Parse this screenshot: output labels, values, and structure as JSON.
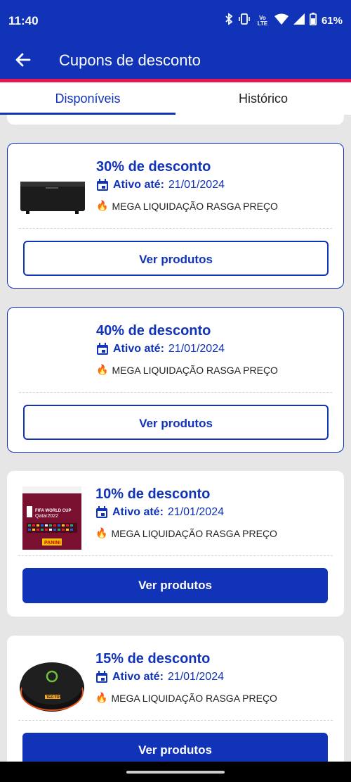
{
  "status_bar": {
    "time": "11:40",
    "signal_label": "Vo LTE",
    "battery": "61%",
    "icons": [
      "bluetooth-icon",
      "vibrate-icon",
      "volte-icon",
      "wifi-icon",
      "signal-icon",
      "battery-icon"
    ]
  },
  "app_bar": {
    "title": "Cupons de desconto",
    "back_icon": "arrow-left-icon"
  },
  "tabs": [
    {
      "label": "Disponíveis",
      "active": true
    },
    {
      "label": "Histórico",
      "active": false
    }
  ],
  "coupons": [
    {
      "discount": "30% de desconto",
      "active_label": "Ativo até:",
      "active_date": "21/01/2024",
      "campaign": "MEGA LIQUIDAÇÃO RASGA PREÇO",
      "button": "Ver produtos",
      "image": "projector"
    },
    {
      "discount": "40% de desconto",
      "active_label": "Ativo até:",
      "active_date": "21/01/2024",
      "campaign": "MEGA LIQUIDAÇÃO RASGA PREÇO",
      "button": "Ver produtos",
      "image": "none"
    },
    {
      "discount": "10% de desconto",
      "active_label": "Ativo até:",
      "active_date": "21/01/2024",
      "campaign": "MEGA LIQUIDAÇÃO RASGA PREÇO",
      "button": "Ver produtos",
      "image": "fifa-world-cup-album",
      "image_text": [
        "FIFA WORLD CUP",
        "Qatar2022",
        "PANINI"
      ]
    },
    {
      "discount": "15% de desconto",
      "active_label": "Ativo até:",
      "active_date": "21/01/2024",
      "campaign": "MEGA LIQUIDAÇÃO RASGA PREÇO",
      "button": "Ver produtos",
      "image": "tv-box",
      "image_text": [
        "TEO TOY"
      ]
    }
  ],
  "colors": {
    "primary": "#1133b8",
    "accent_line": "#e5184e",
    "background": "#e6e6e6",
    "fire": "#e8621c"
  }
}
